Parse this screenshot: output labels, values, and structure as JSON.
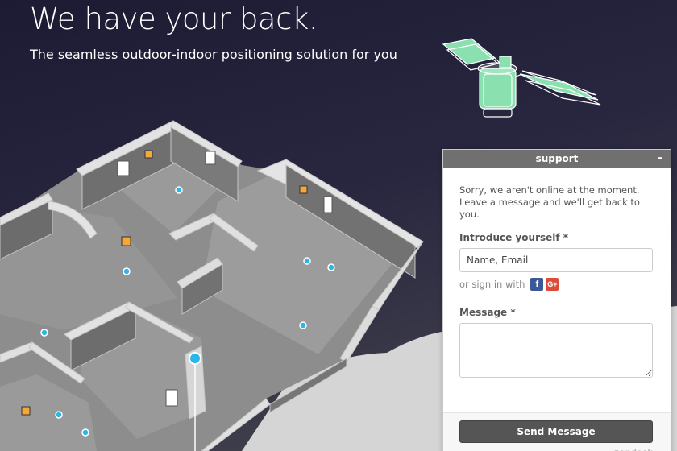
{
  "hero": {
    "title": "We have your back.",
    "subtitle": "The seamless outdoor-indoor positioning solution for you"
  },
  "support_widget": {
    "header": "support",
    "minimize_label": "–",
    "offline_message": "Sorry, we aren't online at the moment. Leave a message and we'll get back to you.",
    "introduce_label": "Introduce yourself *",
    "name_placeholder": "Name, Email",
    "signin_text": "or sign in with",
    "facebook_glyph": "f",
    "google_glyph": "G+",
    "message_label": "Message *",
    "send_button": "Send Message",
    "brand_text": "zendesk"
  },
  "icons": [
    "satellite-icon",
    "facebook-icon",
    "google-plus-icon"
  ],
  "colors": {
    "background_top": "#1c1b33",
    "wifi_marker": "#f4a83a",
    "position_dot": "#29b6e8",
    "satellite_panel": "#8be0b0",
    "widget_header": "#707070",
    "send_button": "#555555"
  }
}
